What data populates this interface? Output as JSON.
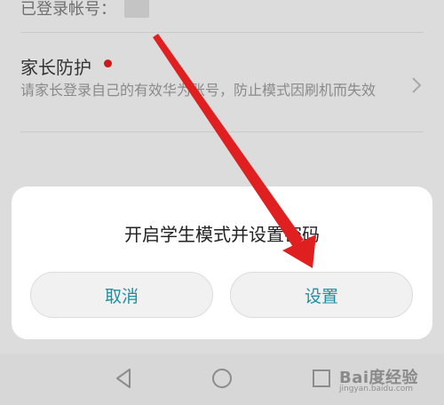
{
  "settings": {
    "logged_account_label": "已登录帐号：",
    "parental_title": "家长防护",
    "parental_desc": "请家长登录自己的有效华为账号，防止模式因刷机而失效"
  },
  "dialog": {
    "title": "开启学生模式并设置密码",
    "cancel_label": "取消",
    "confirm_label": "设置"
  },
  "navbar": {
    "icons": [
      "back-icon",
      "home-icon",
      "recents-icon"
    ]
  },
  "watermark": {
    "brand": "Bai度经验",
    "url": "jingyan.baidu.com"
  },
  "colors": {
    "accent": "#1f8f9f",
    "arrow": "#e02020",
    "badge": "#cc1a1a"
  }
}
